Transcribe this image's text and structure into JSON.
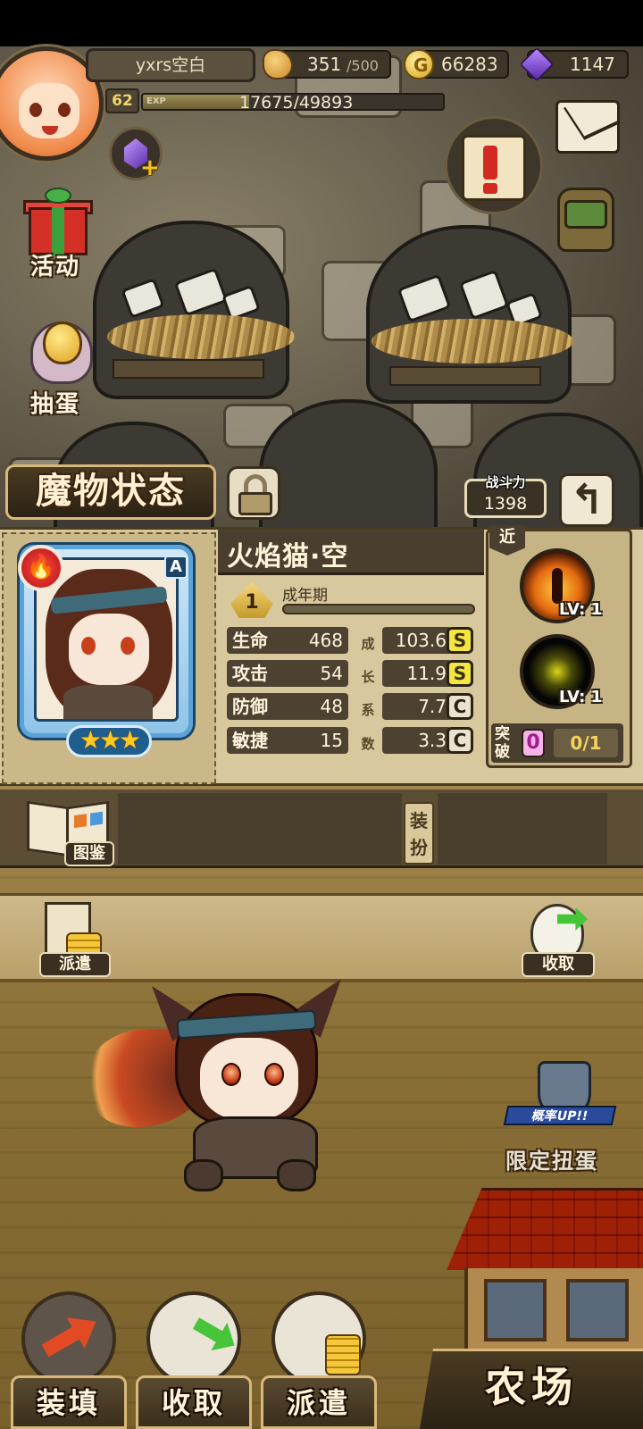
{
  "player": {
    "name": "yxrs空白",
    "level": "62",
    "exp_tag": "EXP",
    "exp_text": "17675/49893",
    "exp_fraction": 0.354
  },
  "resources": {
    "stamina_value": "351",
    "stamina_max": "/500",
    "gold": "66283",
    "gems": "1147"
  },
  "side_menu": {
    "activity_label": "活动",
    "gacha_label": "抽蛋"
  },
  "status": {
    "title": "魔物状态",
    "power_label": "战斗力",
    "power_value": "1398",
    "back_icon": "back-arrow-icon"
  },
  "monster": {
    "name": "火焰猫·空",
    "rank": "A",
    "element_icon": "fire-icon",
    "stars": "★★★",
    "stage_number": "1",
    "stage_label": "成年期",
    "range_label": "近",
    "stats": [
      {
        "name": "生命",
        "value": "468",
        "growth": "103.6",
        "grade": "S"
      },
      {
        "name": "攻击",
        "value": "54",
        "growth": "11.9",
        "grade": "S"
      },
      {
        "name": "防御",
        "value": "48",
        "growth": "7.7",
        "grade": "C"
      },
      {
        "name": "敏捷",
        "value": "15",
        "growth": "3.3",
        "grade": "C"
      }
    ],
    "growth_chars": [
      "成",
      "长",
      "系",
      "数"
    ],
    "skills": [
      {
        "level": "LV: 1"
      },
      {
        "level": "LV: 1"
      }
    ],
    "breakthrough_label": "突破",
    "breakthrough_count": "0",
    "breakthrough_progress": "0/1"
  },
  "subbar": {
    "encyclopedia_label": "图鉴",
    "equip_label": "装扮"
  },
  "ground": {
    "dispatch_label": "派遣",
    "collect_label": "收取",
    "limited_gacha_label": "限定扭蛋",
    "limited_banner": "概率UP!!"
  },
  "bottom": {
    "load_label": "装填",
    "collect_label": "收取",
    "dispatch_label": "派遣",
    "farm_label": "农场"
  },
  "colors": {
    "grade_s": "#f4e640",
    "grade_c": "#eae2cc",
    "panel_bg": "#d8c89e",
    "title_text": "#fff1d2"
  }
}
